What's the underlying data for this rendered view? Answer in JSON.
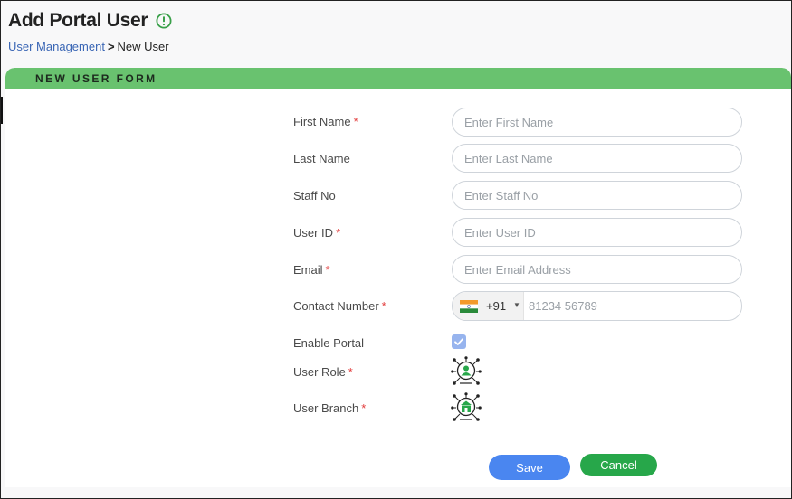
{
  "header": {
    "title": "Add Portal User",
    "info_icon": "info-circle-icon",
    "accent_color": "#3aa04a"
  },
  "breadcrumb": {
    "parent": "User Management",
    "separator": ">",
    "current": "New User"
  },
  "form": {
    "section_title": "NEW USER FORM",
    "header_color": "#69c26f",
    "fields": {
      "first_name": {
        "label": "First Name",
        "required": "*",
        "placeholder": "Enter First Name",
        "value": ""
      },
      "last_name": {
        "label": "Last Name",
        "required": "",
        "placeholder": "Enter Last Name",
        "value": ""
      },
      "staff_no": {
        "label": "Staff No",
        "required": "",
        "placeholder": "Enter Staff No",
        "value": ""
      },
      "user_id": {
        "label": "User ID",
        "required": "*",
        "placeholder": "Enter User ID",
        "value": ""
      },
      "email": {
        "label": "Email",
        "required": "*",
        "placeholder": "Enter Email Address",
        "value": ""
      },
      "contact_number": {
        "label": "Contact Number",
        "required": "*",
        "country_flag": "india-flag-icon",
        "dial_code": "+91",
        "placeholder": "81234 56789",
        "value": ""
      },
      "enable_portal": {
        "label": "Enable Portal",
        "checked": true
      },
      "user_role": {
        "label": "User Role",
        "required": "*",
        "icon": "user-role-network-icon"
      },
      "user_branch": {
        "label": "User Branch",
        "required": "*",
        "icon": "branch-network-icon"
      }
    }
  },
  "actions": {
    "save_label": "Save",
    "cancel_label": "Cancel",
    "save_color": "#4a86f0",
    "cancel_color": "#27a74a"
  }
}
